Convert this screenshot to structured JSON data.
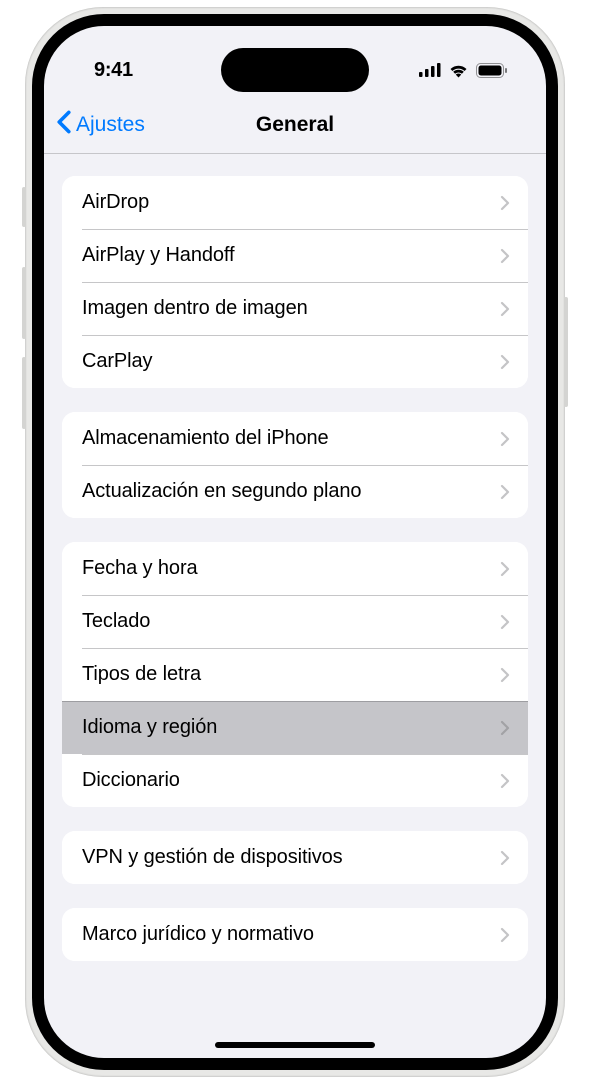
{
  "status": {
    "time": "9:41"
  },
  "nav": {
    "back": "Ajustes",
    "title": "General"
  },
  "groups": [
    {
      "items": [
        {
          "id": "airdrop",
          "label": "AirDrop",
          "highlight": false
        },
        {
          "id": "airplay-handoff",
          "label": "AirPlay y Handoff",
          "highlight": false
        },
        {
          "id": "pip",
          "label": "Imagen dentro de imagen",
          "highlight": false
        },
        {
          "id": "carplay",
          "label": "CarPlay",
          "highlight": false
        }
      ]
    },
    {
      "items": [
        {
          "id": "storage",
          "label": "Almacenamiento del iPhone",
          "highlight": false
        },
        {
          "id": "background-refresh",
          "label": "Actualización en segundo plano",
          "highlight": false
        }
      ]
    },
    {
      "items": [
        {
          "id": "date-time",
          "label": "Fecha y hora",
          "highlight": false
        },
        {
          "id": "keyboard",
          "label": "Teclado",
          "highlight": false
        },
        {
          "id": "fonts",
          "label": "Tipos de letra",
          "highlight": false
        },
        {
          "id": "language-region",
          "label": "Idioma y región",
          "highlight": true
        },
        {
          "id": "dictionary",
          "label": "Diccionario",
          "highlight": false
        }
      ]
    },
    {
      "items": [
        {
          "id": "vpn",
          "label": "VPN y gestión de dispositivos",
          "highlight": false
        }
      ]
    },
    {
      "items": [
        {
          "id": "legal",
          "label": "Marco jurídico y normativo",
          "highlight": false
        }
      ]
    }
  ]
}
